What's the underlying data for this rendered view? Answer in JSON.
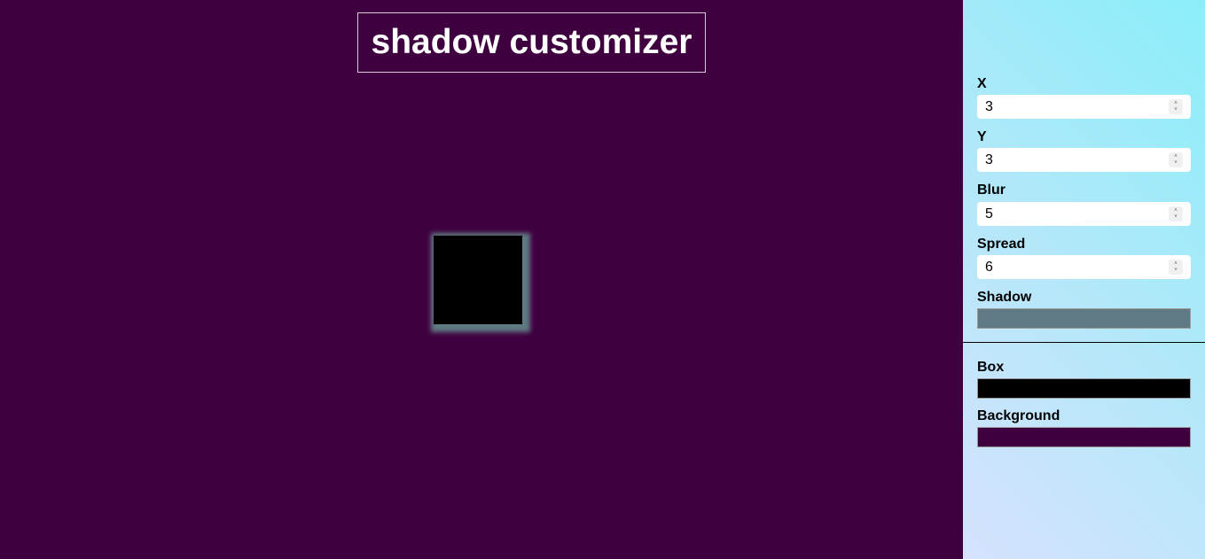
{
  "title": "shadow customizer",
  "colors": {
    "background": "#3f003f",
    "box": "#000000",
    "shadow": "#5f7a82"
  },
  "controls": {
    "x": {
      "label": "X",
      "value": "3"
    },
    "y": {
      "label": "Y",
      "value": "3"
    },
    "blur": {
      "label": "Blur",
      "value": "5"
    },
    "spread": {
      "label": "Spread",
      "value": "6"
    },
    "shadow": {
      "label": "Shadow"
    },
    "box": {
      "label": "Box"
    },
    "background": {
      "label": "Background"
    }
  }
}
